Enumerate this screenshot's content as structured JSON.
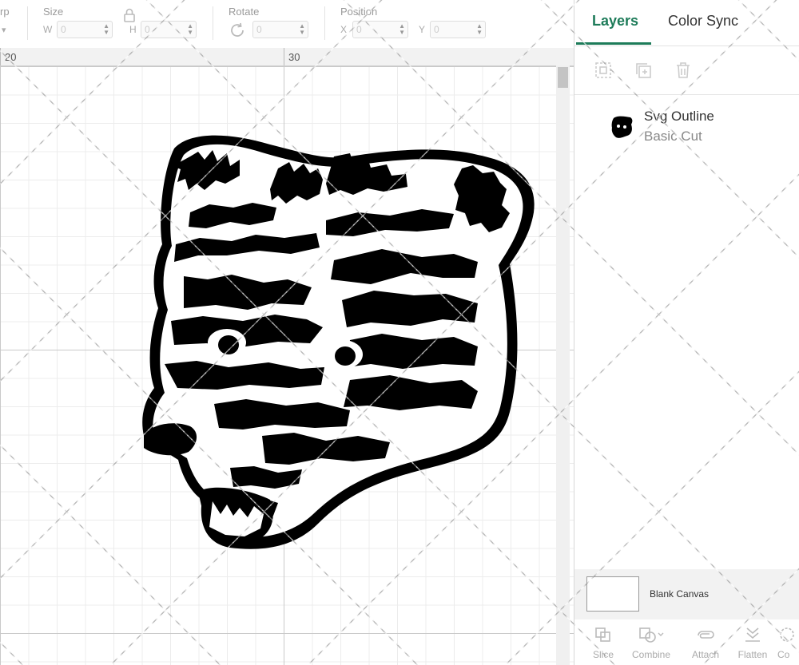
{
  "toolbar": {
    "warp_label": "rp",
    "size_label": "Size",
    "width_prefix": "W",
    "width_value": "0",
    "height_prefix": "H",
    "height_value": "0",
    "rotate_label": "Rotate",
    "rotate_value": "0",
    "position_label": "Position",
    "x_prefix": "X",
    "x_value": "0",
    "y_prefix": "Y",
    "y_value": "0"
  },
  "ruler": {
    "marks": [
      "20",
      "30"
    ]
  },
  "panel": {
    "tabs": [
      {
        "label": "Layers",
        "active": true
      },
      {
        "label": "Color Sync",
        "active": false
      }
    ],
    "actions": [
      "group-icon",
      "duplicate-icon",
      "delete-icon"
    ],
    "layer": {
      "name": "Svg Outline",
      "operation": "Basic Cut"
    },
    "blank_canvas_label": "Blank Canvas",
    "bottom_tools": [
      {
        "label": "Slice",
        "icon": "slice-icon"
      },
      {
        "label": "Combine",
        "icon": "combine-icon"
      },
      {
        "label": "Attach",
        "icon": "attach-icon"
      },
      {
        "label": "Flatten",
        "icon": "flatten-icon"
      },
      {
        "label": "Co",
        "icon": "contour-icon"
      }
    ]
  },
  "colors": {
    "accent": "#1d7b59",
    "design_fill": "#000000"
  }
}
